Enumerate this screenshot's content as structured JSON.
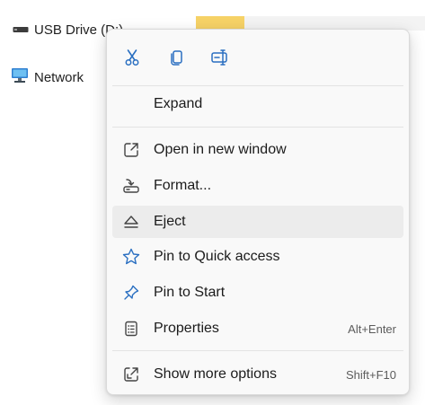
{
  "background_nav": {
    "usb_drive_label": "USB Drive (D:)",
    "network_label": "Network"
  },
  "context_menu": {
    "toolbar": [
      {
        "name": "cut",
        "icon": "scissors-icon"
      },
      {
        "name": "copy",
        "icon": "copy-icon"
      },
      {
        "name": "rename",
        "icon": "rename-icon"
      }
    ],
    "items": {
      "expand": {
        "label": "Expand"
      },
      "open_new_window": {
        "label": "Open in new window",
        "icon": "open-new-window-icon"
      },
      "format": {
        "label": "Format...",
        "icon": "format-drive-icon"
      },
      "eject": {
        "label": "Eject",
        "icon": "eject-icon"
      },
      "pin_quick_access": {
        "label": "Pin to Quick access",
        "icon": "star-icon"
      },
      "pin_start": {
        "label": "Pin to Start",
        "icon": "pin-icon"
      },
      "properties": {
        "label": "Properties",
        "shortcut": "Alt+Enter",
        "icon": "properties-icon"
      },
      "show_more": {
        "label": "Show more options",
        "shortcut": "Shift+F10",
        "icon": "show-more-icon"
      }
    }
  },
  "colors": {
    "accent": "#2a6fc1",
    "menu_background": "#f9f9f9",
    "hover_background": "#ececec",
    "folder_yellow": "#f6d267"
  }
}
